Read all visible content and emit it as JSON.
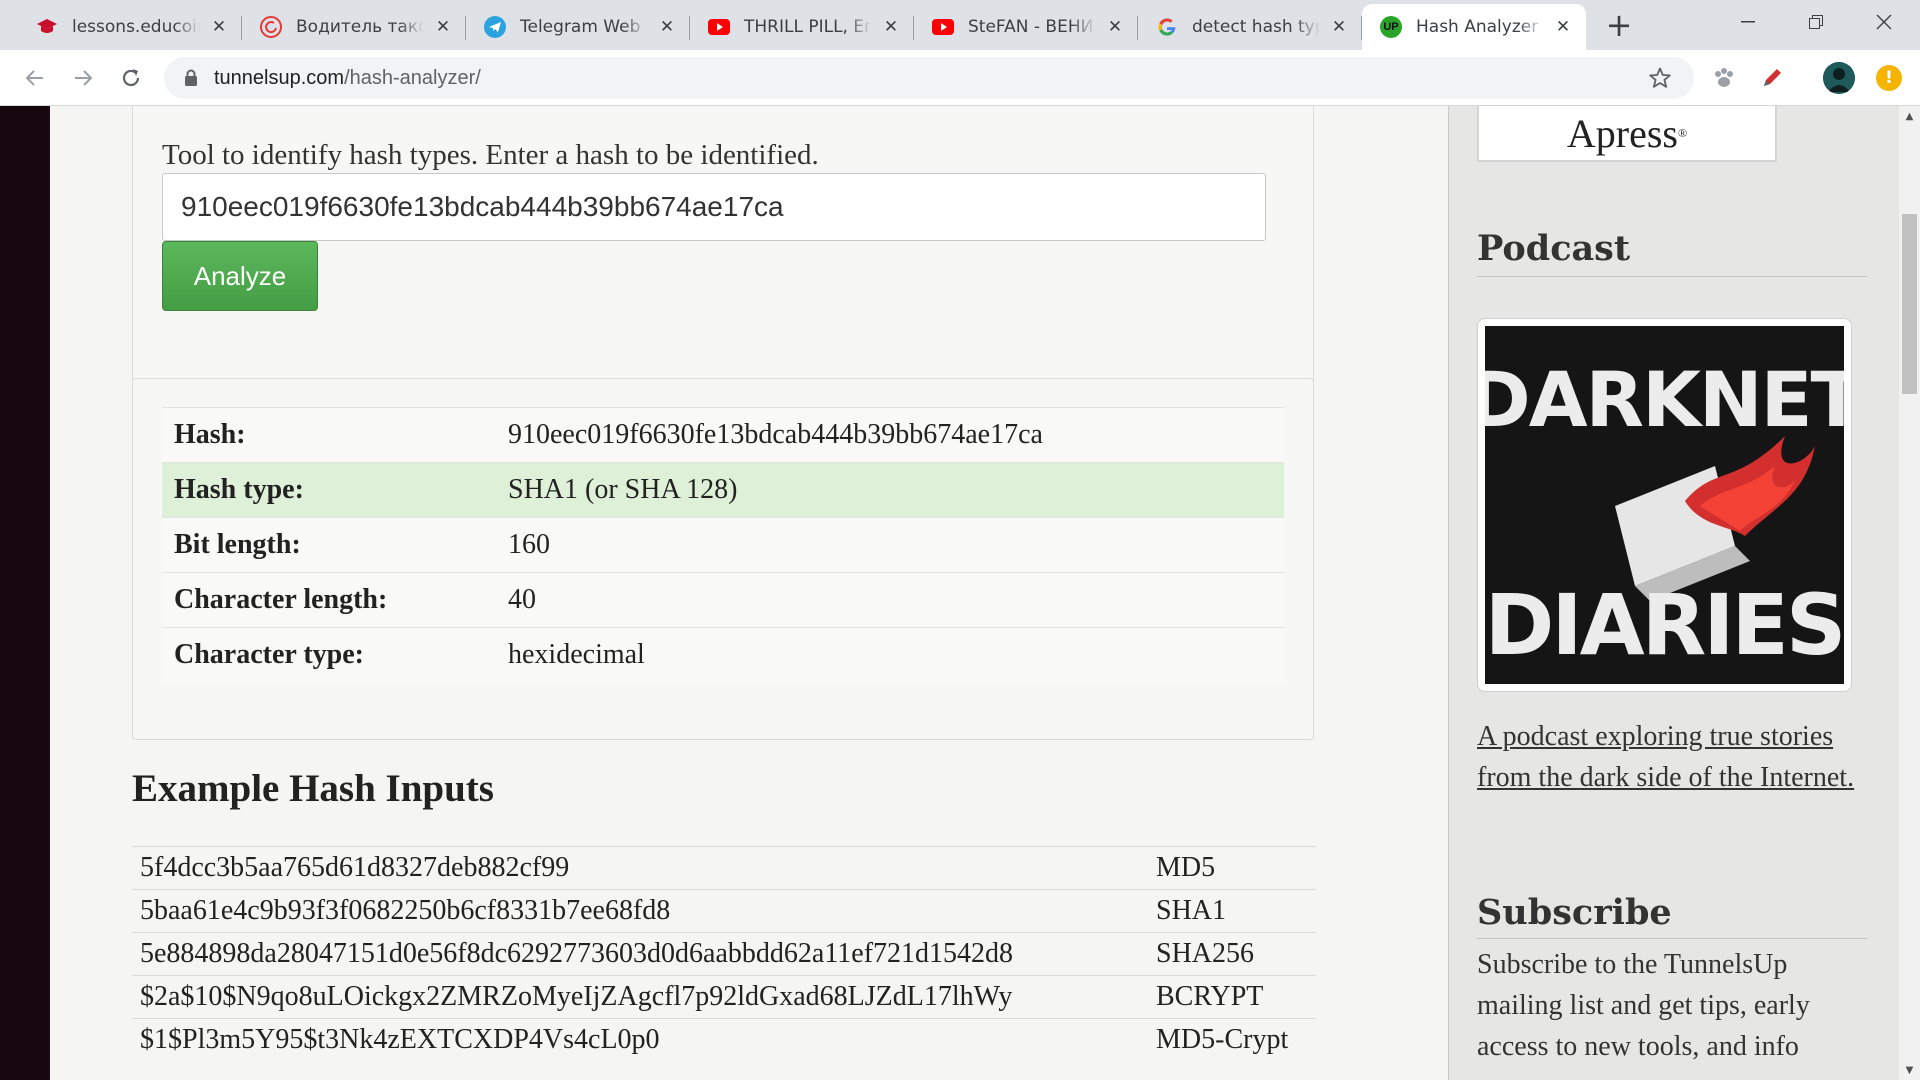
{
  "browser": {
    "tabs": [
      {
        "title": "lessons.educoin",
        "icon": "graduation-cap-icon",
        "color": "#c8102e"
      },
      {
        "title": "Водитель такси",
        "icon": "refresh-circle-icon",
        "color": "#e53935"
      },
      {
        "title": "Telegram Web",
        "icon": "telegram-icon",
        "color": "#2aa3df"
      },
      {
        "title": "THRILL PILL, Eго",
        "icon": "youtube-icon",
        "color": "#ff0000"
      },
      {
        "title": "SteFAN - ВЕНИ",
        "icon": "youtube-icon",
        "color": "#ff0000"
      },
      {
        "title": "detect hash type",
        "icon": "google-icon",
        "color": "#4285f4"
      },
      {
        "title": "Hash Analyzer -",
        "icon": "up-logo-icon",
        "color": "#2aa52a"
      }
    ],
    "active_tab": 6,
    "address": {
      "host": "tunnelsup.com",
      "path": "/hash-analyzer/"
    }
  },
  "tool": {
    "intro": "Tool to identify hash types. Enter a hash to be identified.",
    "input_value": "910eec019f6630fe13bdcab444b39bb674ae17ca",
    "analyze_label": "Analyze"
  },
  "result": {
    "rows": [
      {
        "label": "Hash:",
        "value": "910eec019f6630fe13bdcab444b39bb674ae17ca"
      },
      {
        "label": "Hash type:",
        "value": "SHA1 (or SHA 128)"
      },
      {
        "label": "Bit length:",
        "value": "160"
      },
      {
        "label": "Character length:",
        "value": "40"
      },
      {
        "label": "Character type:",
        "value": "hexidecimal"
      }
    ],
    "highlight_color": "#dff0d8"
  },
  "examples": {
    "heading": "Example Hash Inputs",
    "rows": [
      {
        "hash": "5f4dcc3b5aa765d61d8327deb882cf99",
        "type": "MD5"
      },
      {
        "hash": "5baa61e4c9b93f3f0682250b6cf8331b7ee68fd8",
        "type": "SHA1"
      },
      {
        "hash": "5e884898da28047151d0e56f8dc6292773603d0d6aabbdd62a11ef721d1542d8",
        "type": "SHA256"
      },
      {
        "hash": "$2a$10$N9qo8uLOickgx2ZMRZoMyeIjZAgcfl7p92ldGxad68LJZdL17lhWy",
        "type": "BCRYPT"
      },
      {
        "hash": "$1$Pl3m5Y95$t3Nk4zEXTCXDP4Vs4cL0p0",
        "type": "MD5-Crypt"
      }
    ]
  },
  "sidebar": {
    "apress": "Apress",
    "podcast_heading": "Podcast",
    "cover_line1": "DARKNET",
    "cover_line2": "DIARIES",
    "podcast_link": "A podcast exploring true stories from the dark side of the Internet.",
    "subscribe_heading": "Subscribe",
    "subscribe_text": "Subscribe to the TunnelsUp mailing list and get tips, early access to new tools, and info"
  }
}
